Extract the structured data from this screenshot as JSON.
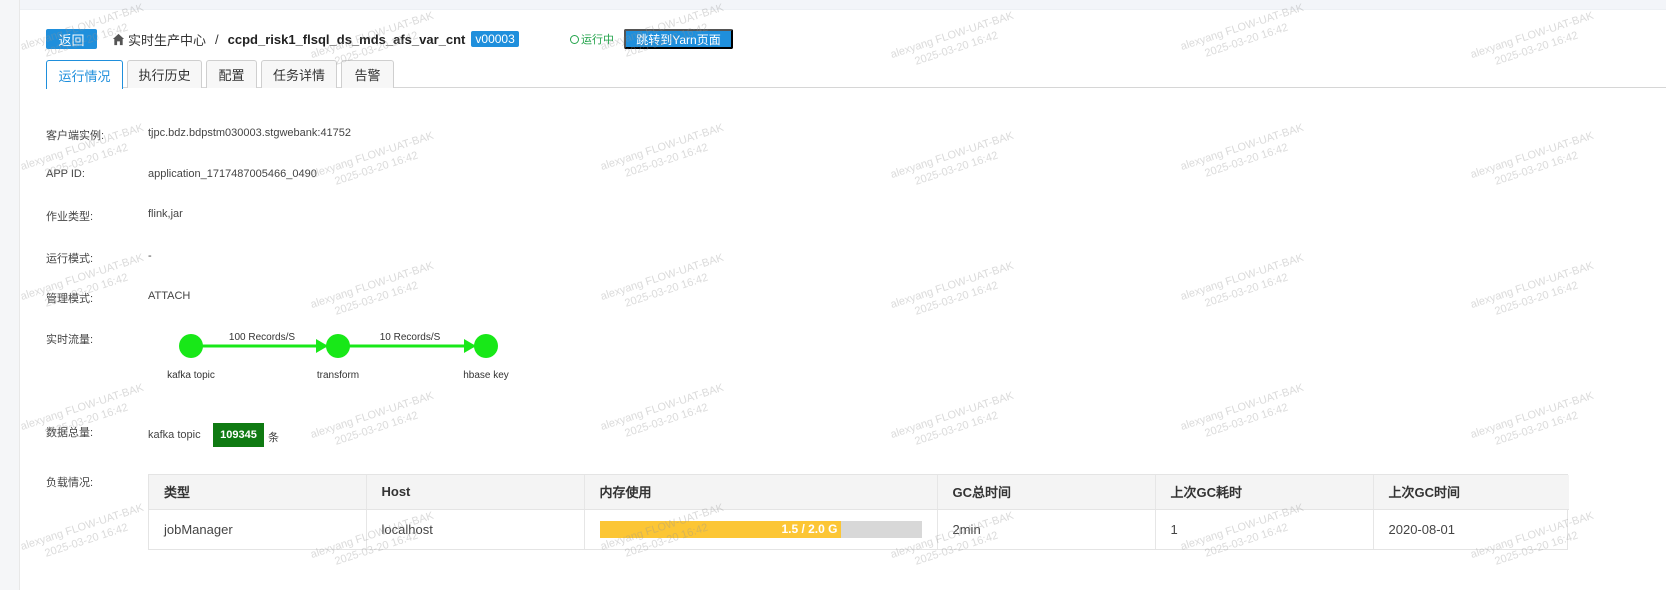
{
  "header": {
    "back_label": "返回",
    "breadcrumb_root": "实时生产中心",
    "breadcrumb_sep": "/",
    "job_name": "ccpd_risk1_flsql_ds_mds_afs_var_cnt",
    "version": "v00003",
    "status": "运行中",
    "yarn_button": "跳转到Yarn页面"
  },
  "tabs": [
    "运行情况",
    "执行历史",
    "配置",
    "任务详情",
    "告警"
  ],
  "active_tab": "运行情况",
  "fields": {
    "client_label": "客户端实例:",
    "client_value": "tjpc.bdz.bdpstm030003.stgwebank:41752",
    "app_id_label": "APP ID:",
    "app_id_value": "application_1717487005466_0490",
    "job_type_label": "作业类型:",
    "job_type_value": "flink,jar",
    "run_mode_label": "运行模式:",
    "run_mode_value": "-",
    "manage_mode_label": "管理模式:",
    "manage_mode_value": "ATTACH",
    "flow_label": "实时流量:",
    "total_label": "数据总量:",
    "total_source": "kafka topic",
    "total_count": "109345",
    "total_unit": "条",
    "load_label": "负载情况:"
  },
  "flow": {
    "nodes": [
      "kafka topic",
      "transform",
      "hbase key"
    ],
    "edges": [
      "100 Records/S",
      "10 Records/S"
    ],
    "color": "#18e818"
  },
  "load_table": {
    "headers": [
      "类型",
      "Host",
      "内存使用",
      "GC总时间",
      "上次GC耗时",
      "上次GC时间"
    ],
    "rows": [
      {
        "type": "jobManager",
        "host": "localhost",
        "memory_text": "1.5 / 2.0 G",
        "memory_fraction": 0.75,
        "gc_total": "2min",
        "last_gc_cost": "1",
        "last_gc_time": "2020-08-01"
      }
    ]
  },
  "watermark": {
    "line1": "alexyang FLOW-UAT-BAK",
    "line2": "2025-03-20 16:42"
  },
  "colors": {
    "accent": "#1f8fdc",
    "running": "#22a34a",
    "count_bg": "#0f7a12",
    "memory_fill": "#fcc635"
  }
}
